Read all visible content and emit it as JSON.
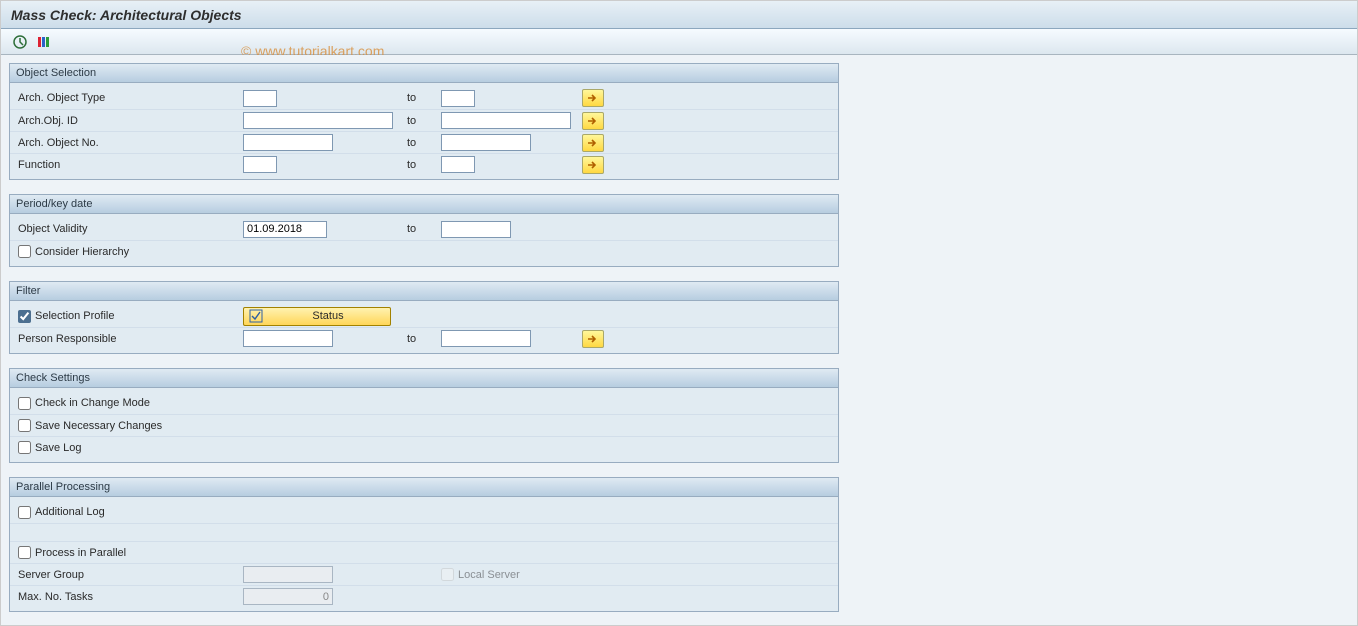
{
  "header": {
    "title": "Mass Check: Architectural Objects"
  },
  "watermark": "© www.tutorialkart.com",
  "labels": {
    "to": "to"
  },
  "groups": {
    "objectSelection": {
      "title": "Object Selection",
      "archObjectType": {
        "label": "Arch. Object Type",
        "from": "",
        "to": ""
      },
      "archObjId": {
        "label": "Arch.Obj. ID",
        "from": "",
        "to": ""
      },
      "archObjectNo": {
        "label": "Arch. Object No.",
        "from": "",
        "to": ""
      },
      "function": {
        "label": "Function",
        "from": "",
        "to": ""
      }
    },
    "period": {
      "title": "Period/key date",
      "objectValidity": {
        "label": "Object Validity",
        "from": "01.09.2018",
        "to": ""
      },
      "considerHierarchy": {
        "label": "Consider Hierarchy",
        "checked": false
      }
    },
    "filter": {
      "title": "Filter",
      "selectionProfile": {
        "label": "Selection Profile",
        "checked": true,
        "button": "Status"
      },
      "personResponsible": {
        "label": "Person Responsible",
        "from": "",
        "to": ""
      }
    },
    "checkSettings": {
      "title": "Check Settings",
      "checkInChangeMode": {
        "label": "Check in Change Mode",
        "checked": false
      },
      "saveNecessaryChanges": {
        "label": "Save Necessary Changes",
        "checked": false
      },
      "saveLog": {
        "label": "Save Log",
        "checked": false
      }
    },
    "parallel": {
      "title": "Parallel Processing",
      "additionalLog": {
        "label": "Additional Log",
        "checked": false
      },
      "processInParallel": {
        "label": "Process in Parallel",
        "checked": false
      },
      "serverGroup": {
        "label": "Server Group",
        "value": ""
      },
      "localServer": {
        "label": "Local Server",
        "checked": false
      },
      "maxNoTasks": {
        "label": "Max. No. Tasks",
        "value": "0"
      }
    }
  }
}
